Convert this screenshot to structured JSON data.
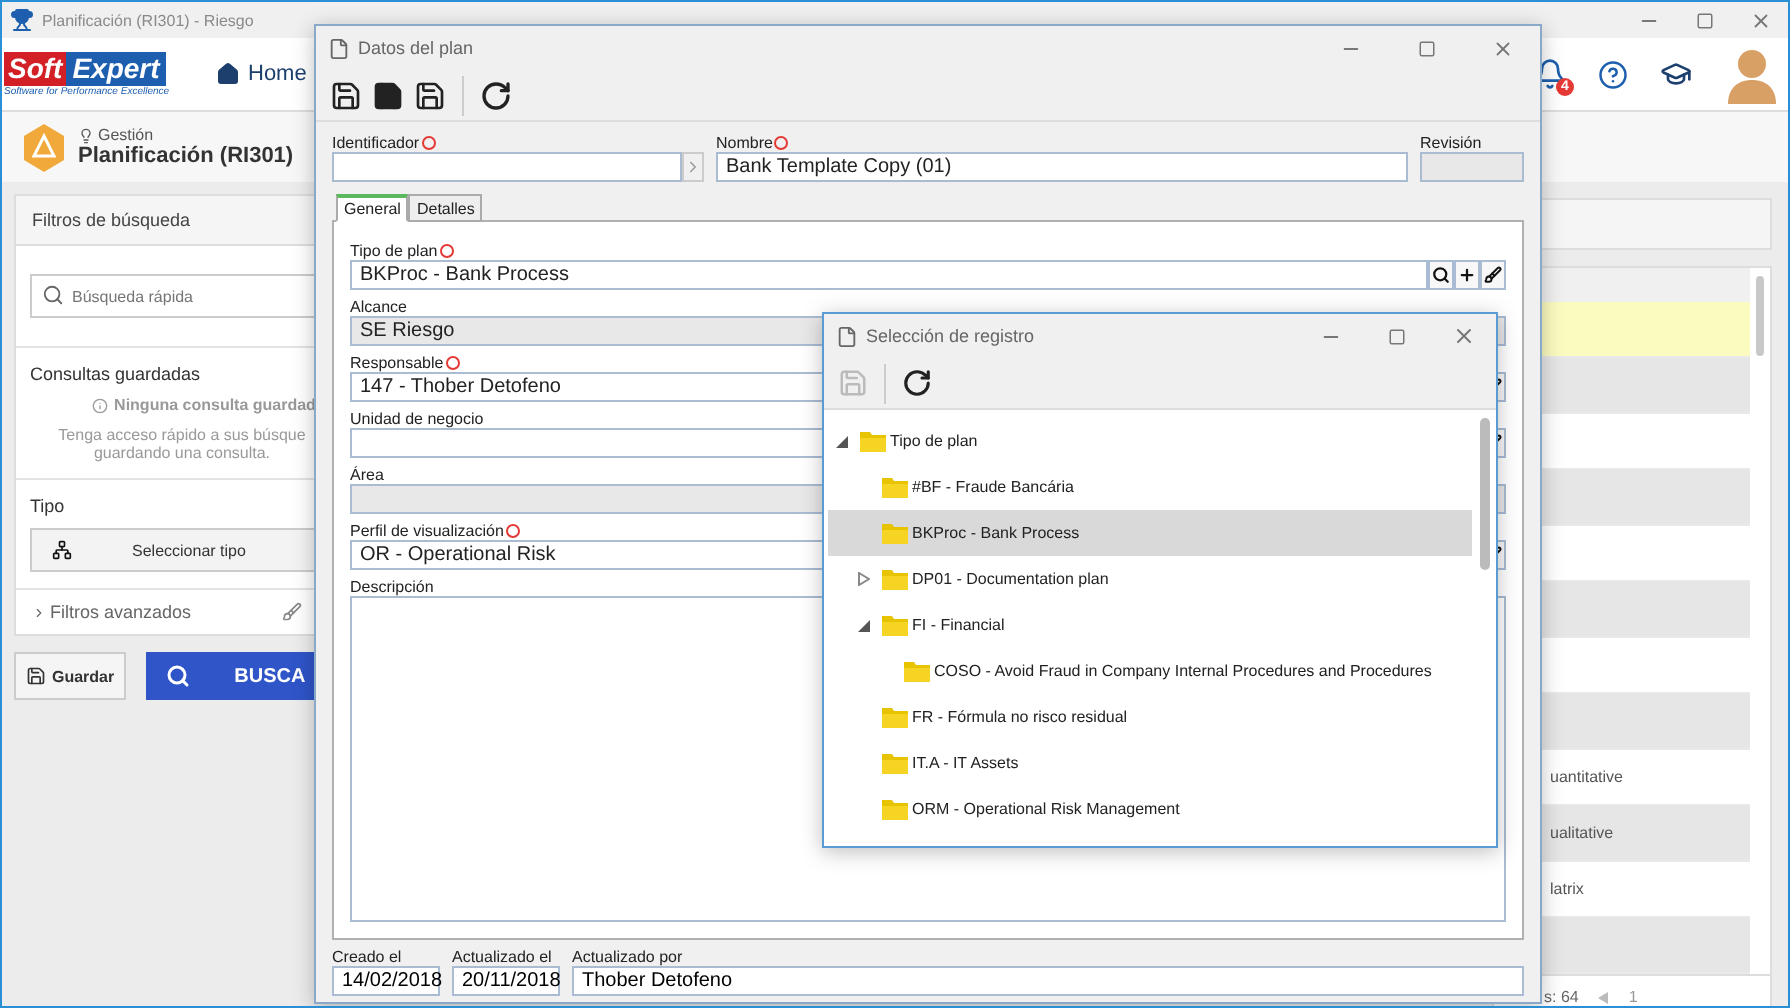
{
  "app_window": {
    "title": "Planificación (RI301) - Riesgo"
  },
  "header": {
    "logo_left": "Soft",
    "logo_right": "Expert",
    "logo_tagline": "Software for Performance Excellence",
    "home": "Home",
    "notification_count": "4"
  },
  "page": {
    "breadcrumb": "Gestión",
    "title": "Planificación (RI301)"
  },
  "filters": {
    "title": "Filtros de búsqueda",
    "search_placeholder": "Búsqueda rápida",
    "saved_title": "Consultas guardadas",
    "saved_empty": "Ninguna consulta guardad",
    "saved_hint": "Tenga acceso rápido a sus búsque guardando una consulta.",
    "type_title": "Tipo",
    "type_button": "Seleccionar tipo",
    "advanced": "Filtros avanzados",
    "save_button": "Guardar",
    "search_button": "BUSCA"
  },
  "results": {
    "rows": [
      {
        "selected": true
      },
      {
        "selected": false
      },
      {
        "selected": false
      },
      {
        "selected": false
      },
      {
        "selected": false
      },
      {
        "selected": false
      },
      {
        "selected": false
      },
      {
        "selected": false
      },
      {
        "selected": false,
        "text": "uantitative"
      },
      {
        "selected": false,
        "text": "ualitative"
      },
      {
        "selected": false,
        "text": "latrix"
      },
      {
        "selected": false
      }
    ],
    "count": "s: 64",
    "page": "1"
  },
  "plan_dialog": {
    "title": "Datos del plan",
    "top_fields": [
      {
        "label": "Identificador",
        "required": true,
        "kind": "goto"
      },
      {
        "label": "Nombre",
        "required": true,
        "value": "Bank Template Copy (01)",
        "kind": "text"
      },
      {
        "label": "Revisión",
        "required": false,
        "kind": "disabled"
      }
    ],
    "tabs": [
      {
        "label": "General",
        "selected": true
      },
      {
        "label": "Detalles",
        "selected": false
      }
    ],
    "fields": [
      {
        "label": "Tipo de plan",
        "required": true,
        "value": "BKProc - Bank Process",
        "kind": "lookup"
      },
      {
        "label": "Alcance",
        "required": false,
        "value": "SE Riesgo",
        "kind": "disabled"
      },
      {
        "label": "Responsable",
        "required": true,
        "value": "147 - Thober Detofeno",
        "kind": "clearable"
      },
      {
        "label": "Unidad de negocio",
        "required": false,
        "kind": "clearable"
      },
      {
        "label": "Área",
        "required": false,
        "kind": "disabled"
      },
      {
        "label": "Perfil de visualización",
        "required": true,
        "value": "OR - Operational Risk",
        "kind": "clearable"
      },
      {
        "label": "Descripción",
        "required": false,
        "kind": "textarea"
      }
    ],
    "footer": [
      {
        "label": "Creado el",
        "value": "14/02/2018"
      },
      {
        "label": "Actualizado el",
        "value": "20/11/2018"
      },
      {
        "label": "Actualizado por",
        "value": "Thober Detofeno"
      }
    ]
  },
  "select_dialog": {
    "title": "Selección de registro",
    "tree": [
      {
        "label": "Tipo de plan",
        "selected": false,
        "expanded": true,
        "children": [
          {
            "label": "#BF - Fraude Bancária",
            "selected": false
          },
          {
            "label": "BKProc - Bank Process",
            "selected": true
          },
          {
            "label": "DP01 - Documentation plan",
            "selected": false,
            "expanded": false
          },
          {
            "label": "FI - Financial",
            "selected": false,
            "expanded": true,
            "children": [
              {
                "label": "COSO - Avoid Fraud in Company Internal Procedures and Procedures",
                "selected": false
              }
            ]
          },
          {
            "label": "FR - Fórmula no risco residual",
            "selected": false
          },
          {
            "label": "IT.A - IT Assets",
            "selected": false
          },
          {
            "label": "ORM - Operational Risk Management",
            "selected": false
          }
        ]
      }
    ]
  }
}
